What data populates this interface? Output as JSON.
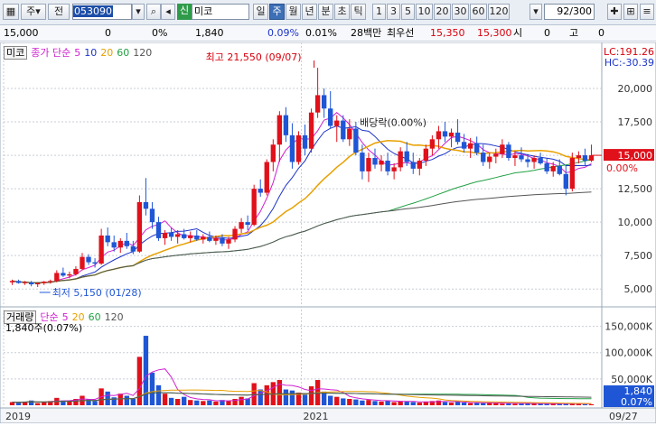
{
  "toolbar": {
    "period_prefix": "주",
    "prev_label": "전",
    "stock_code": "053090",
    "market_badge": "신",
    "stock_name": "미코",
    "period_tabs": [
      "일",
      "주",
      "월",
      "년",
      "분",
      "초",
      "틱"
    ],
    "active_period": "주",
    "interval_buttons": [
      "1",
      "3",
      "5",
      "10",
      "20",
      "30",
      "60",
      "120"
    ],
    "count_value": "92",
    "count_total": "/300"
  },
  "info": {
    "price": "15,000",
    "change": "0",
    "change_pct": "0%",
    "volume": "1,840",
    "vol_pct": "0.09%",
    "turnover_pct": "0.01%",
    "trade_amount": "28백만",
    "best_ask_label": "최우선",
    "best_ask": "15,350",
    "best_bid": "15,300",
    "open_label": "시",
    "open": "0",
    "high_label": "고",
    "high": "0"
  },
  "price_panel": {
    "title": "미코",
    "legend_label": "종가 단순",
    "ma_periods": [
      "5",
      "10",
      "20",
      "60",
      "120"
    ],
    "ma_colors": [
      "#d020d0",
      "#1c34c8",
      "#e8a000",
      "#22a044",
      "#555555"
    ],
    "lc_label": "LC:191.26",
    "hc_label": "HC:-30.39",
    "high_annotation": "최고 21,550 (09/07)",
    "low_annotation": "최저 5,150 (01/28)",
    "dividend_annotation": "배당락(0.00%)",
    "current_price_tag": "15,000",
    "current_pct_tag": "0.00%",
    "y_ticks": [
      "20,000",
      "17,500",
      "15,000",
      "12,500",
      "10,000",
      "7,500",
      "5,000"
    ]
  },
  "volume_panel": {
    "legend_label": "거래량",
    "legend_ma": "단순",
    "ma_periods": [
      "5",
      "20",
      "60",
      "120"
    ],
    "volume_annotation": "1,840주(0.07%)",
    "y_ticks": [
      "150,000K",
      "100,000K",
      "50,000K"
    ],
    "current_tag": "1,840",
    "current_pct": "0.07%"
  },
  "x_axis": {
    "labels": [
      "2019",
      "2021",
      "09/27"
    ]
  },
  "chart_data": {
    "type": "candlestick",
    "title": "미코",
    "candles": [
      [
        5500,
        5700,
        5300,
        5600
      ],
      [
        5600,
        5700,
        5400,
        5450
      ],
      [
        5450,
        5600,
        5300,
        5500
      ],
      [
        5500,
        5600,
        5200,
        5350
      ],
      [
        5350,
        5500,
        5150,
        5450
      ],
      [
        5450,
        5600,
        5300,
        5550
      ],
      [
        5550,
        5700,
        5400,
        5600
      ],
      [
        5600,
        6400,
        5500,
        6200
      ],
      [
        6200,
        6600,
        5900,
        6000
      ],
      [
        6000,
        6300,
        5800,
        6100
      ],
      [
        6100,
        6700,
        6000,
        6500
      ],
      [
        6500,
        7700,
        6400,
        7400
      ],
      [
        7400,
        7600,
        6800,
        7000
      ],
      [
        7000,
        7300,
        6600,
        6900
      ],
      [
        6900,
        9500,
        6800,
        9000
      ],
      [
        9000,
        9600,
        8200,
        8500
      ],
      [
        8500,
        9000,
        7800,
        8100
      ],
      [
        8100,
        8800,
        7700,
        8600
      ],
      [
        8600,
        9200,
        8000,
        8200
      ],
      [
        8200,
        8600,
        7600,
        7800
      ],
      [
        7800,
        12000,
        7700,
        11500
      ],
      [
        11500,
        13300,
        10500,
        11000
      ],
      [
        11000,
        11500,
        9500,
        10000
      ],
      [
        10000,
        10400,
        8600,
        8800
      ],
      [
        8800,
        9400,
        8300,
        9200
      ],
      [
        9200,
        9600,
        8600,
        8900
      ],
      [
        8900,
        9400,
        8400,
        9100
      ],
      [
        9100,
        9500,
        8700,
        8800
      ],
      [
        8800,
        9300,
        8500,
        9000
      ],
      [
        9000,
        9400,
        8600,
        8700
      ],
      [
        8700,
        9100,
        8400,
        8900
      ],
      [
        8900,
        9300,
        8500,
        8600
      ],
      [
        8600,
        9000,
        8300,
        8800
      ],
      [
        8800,
        9100,
        8200,
        8400
      ],
      [
        8400,
        8900,
        8000,
        8700
      ],
      [
        8700,
        9700,
        8500,
        9500
      ],
      [
        9500,
        10300,
        9200,
        10000
      ],
      [
        10000,
        10500,
        9400,
        9800
      ],
      [
        9800,
        12800,
        9700,
        12500
      ],
      [
        12500,
        13200,
        11900,
        12200
      ],
      [
        12200,
        14700,
        12000,
        14500
      ],
      [
        14500,
        16200,
        13800,
        15800
      ],
      [
        15800,
        18300,
        14500,
        18000
      ],
      [
        18000,
        18600,
        16000,
        16500
      ],
      [
        16500,
        17400,
        14000,
        14500
      ],
      [
        14500,
        16800,
        14300,
        16500
      ],
      [
        16500,
        17300,
        15000,
        15500
      ],
      [
        15500,
        18500,
        15200,
        18200
      ],
      [
        18200,
        21550,
        17800,
        19500
      ],
      [
        19500,
        20000,
        17800,
        18500
      ],
      [
        18500,
        19800,
        17000,
        17200
      ],
      [
        17200,
        18000,
        16000,
        17600
      ],
      [
        17600,
        18000,
        16000,
        16200
      ],
      [
        16200,
        17700,
        15700,
        17000
      ],
      [
        17000,
        17500,
        15000,
        15200
      ],
      [
        15200,
        15800,
        13200,
        13800
      ],
      [
        13800,
        15200,
        13000,
        14800
      ],
      [
        14800,
        15500,
        14000,
        14300
      ],
      [
        14300,
        15000,
        13800,
        14600
      ],
      [
        14600,
        15200,
        13500,
        13800
      ],
      [
        13800,
        14400,
        13200,
        14100
      ],
      [
        14100,
        15600,
        13800,
        15300
      ],
      [
        15300,
        16000,
        14200,
        14500
      ],
      [
        14500,
        15200,
        13600,
        14000
      ],
      [
        14000,
        14800,
        13500,
        14600
      ],
      [
        14600,
        15800,
        14200,
        15500
      ],
      [
        15500,
        16500,
        15000,
        16200
      ],
      [
        16200,
        17200,
        15500,
        16800
      ],
      [
        16800,
        17500,
        16000,
        16400
      ],
      [
        16400,
        17000,
        15600,
        16700
      ],
      [
        16700,
        17700,
        15800,
        16000
      ],
      [
        16000,
        16600,
        15200,
        15500
      ],
      [
        15500,
        16300,
        14800,
        15900
      ],
      [
        15900,
        16400,
        15000,
        15200
      ],
      [
        15200,
        15800,
        14200,
        14500
      ],
      [
        14500,
        15200,
        14000,
        14900
      ],
      [
        14900,
        15500,
        14400,
        15100
      ],
      [
        15100,
        16200,
        14800,
        15800
      ],
      [
        15800,
        16000,
        14600,
        14800
      ],
      [
        14800,
        15300,
        14200,
        15000
      ],
      [
        15000,
        15600,
        14500,
        14700
      ],
      [
        14700,
        15100,
        14100,
        14500
      ],
      [
        14500,
        15000,
        14000,
        14800
      ],
      [
        14800,
        15200,
        14300,
        14400
      ],
      [
        14400,
        14800,
        13600,
        13800
      ],
      [
        13800,
        14500,
        13400,
        14200
      ],
      [
        14200,
        14700,
        13500,
        13600
      ],
      [
        13600,
        14200,
        12000,
        12500
      ],
      [
        12500,
        15200,
        12300,
        14800
      ],
      [
        14800,
        15300,
        14400,
        15000
      ],
      [
        15000,
        15500,
        14200,
        14600
      ],
      [
        14600,
        15800,
        14500,
        15000
      ]
    ],
    "volumes": [
      6000,
      5000,
      7000,
      9000,
      4000,
      6000,
      8000,
      14000,
      9000,
      7000,
      12000,
      18000,
      11000,
      8000,
      32000,
      26000,
      15000,
      22000,
      18000,
      12000,
      92000,
      132000,
      62000,
      38000,
      22000,
      14000,
      12000,
      16000,
      10000,
      9000,
      8000,
      9000,
      7000,
      10000,
      8000,
      12000,
      16000,
      13000,
      42000,
      30000,
      38000,
      44000,
      48000,
      30000,
      28000,
      24000,
      20000,
      36000,
      48000,
      26000,
      18000,
      16000,
      13000,
      12000,
      11000,
      9000,
      10000,
      8000,
      7000,
      9000,
      6000,
      8000,
      7000,
      6000,
      5000,
      7000,
      8000,
      9000,
      6000,
      5000,
      6000,
      5000,
      4000,
      5000,
      4000,
      5000,
      4000,
      3000,
      4000,
      3000,
      3000,
      4000,
      3000,
      3000,
      2500,
      3000,
      2500,
      4000,
      3000,
      2500,
      2000,
      1840
    ],
    "ylim": [
      4000,
      22500
    ],
    "volume_ylim": [
      0,
      175000
    ],
    "x_labels": [
      "2019",
      "2021",
      "09/27"
    ]
  }
}
